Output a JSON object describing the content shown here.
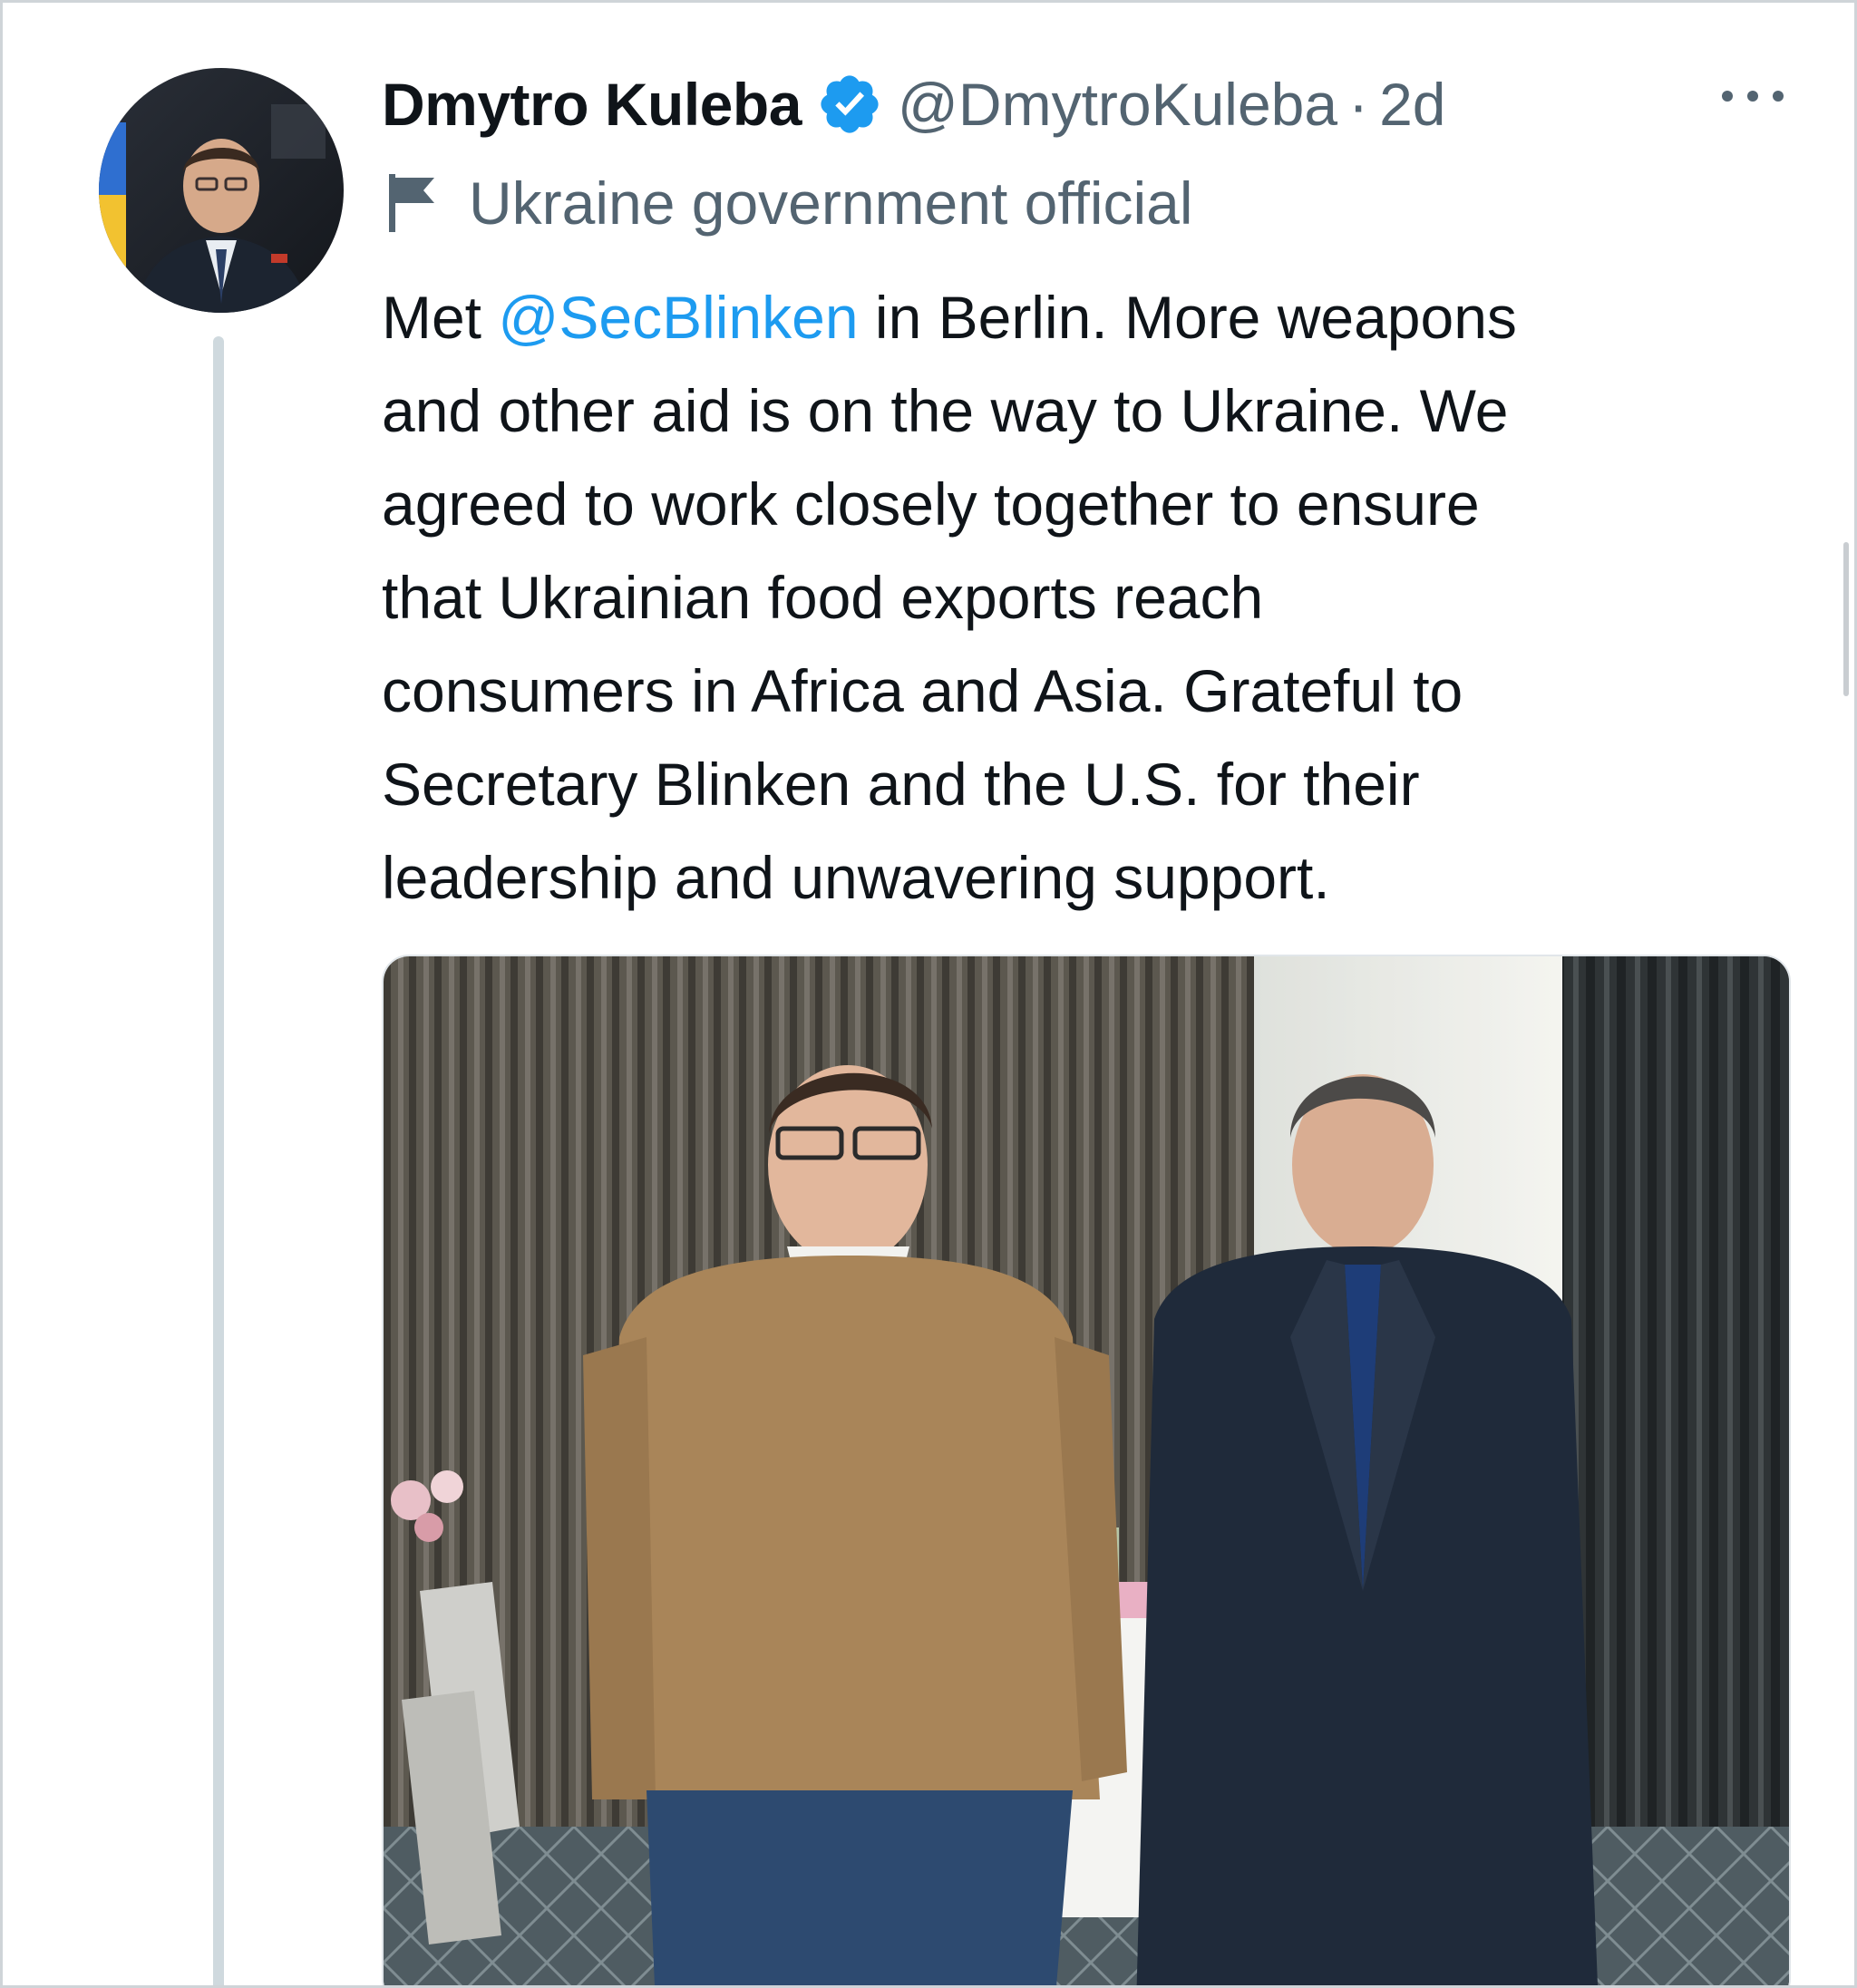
{
  "tweet": {
    "display_name": "Dmytro Kuleba",
    "verified_icon": "verified-badge-icon",
    "handle": "@DmytroKuleba",
    "separator": "·",
    "time": "2d",
    "more_icon": "more-horizontal-icon",
    "label_icon": "flag-icon",
    "label": "Ukraine government official",
    "body_lines": [
      {
        "pre": "Met ",
        "mention": "@SecBlinken",
        "post": " in Berlin. More weapons"
      },
      {
        "text": "and other aid is on the way to Ukraine. We"
      },
      {
        "text": "agreed to work closely together to ensure"
      },
      {
        "text": "that Ukrainian food exports reach"
      },
      {
        "text": "consumers in Africa and Asia. Grateful to"
      },
      {
        "text": "Secretary Blinken and the U.S. for their"
      },
      {
        "text": "leadership and unwavering support."
      }
    ]
  },
  "colors": {
    "text_primary": "#0f1419",
    "text_secondary": "#536471",
    "link": "#1d9bf0",
    "verified": "#1d9bf0",
    "thread_line": "#cfd9de"
  }
}
